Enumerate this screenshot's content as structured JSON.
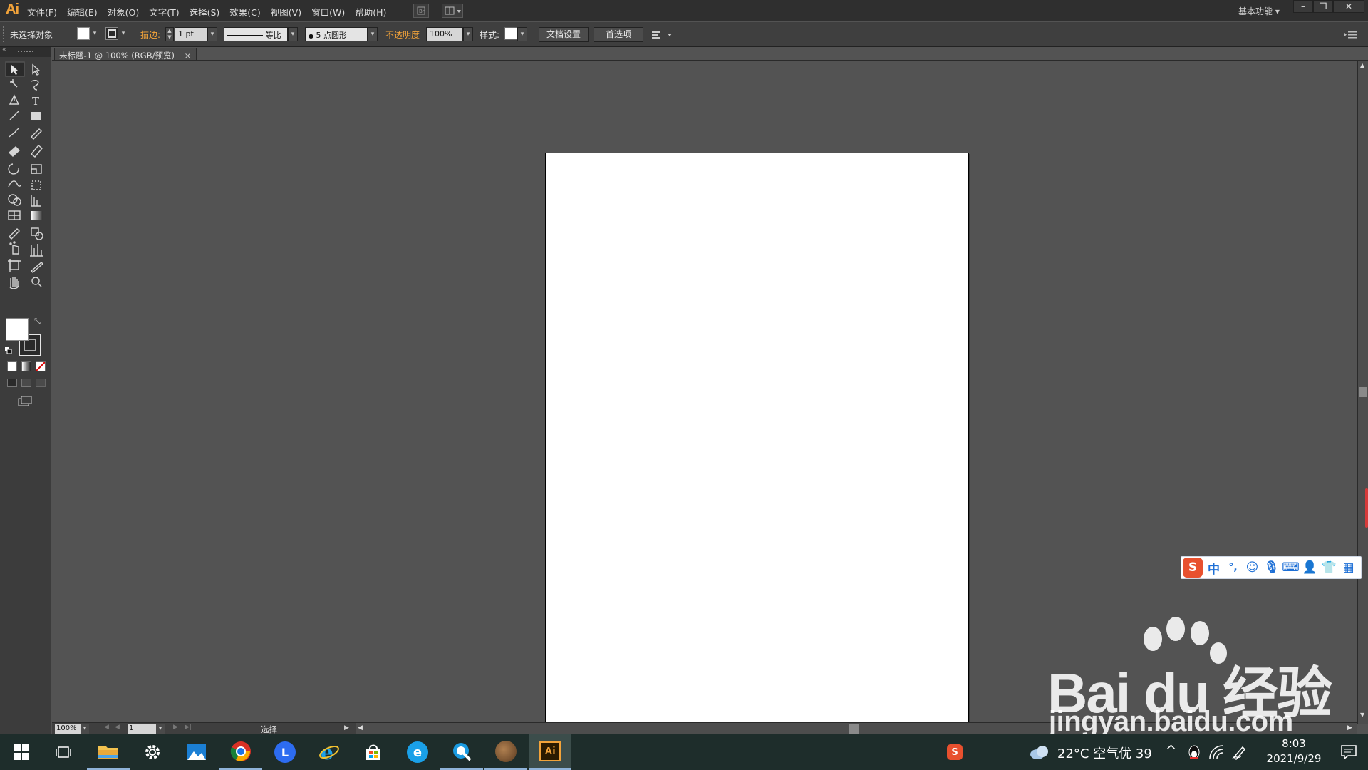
{
  "app": {
    "logo": "Ai",
    "menus": [
      "文件(F)",
      "编辑(E)",
      "对象(O)",
      "文字(T)",
      "选择(S)",
      "效果(C)",
      "视图(V)",
      "窗口(W)",
      "帮助(H)"
    ],
    "workspace": "基本功能",
    "window_controls": [
      "–",
      "❐",
      "✕"
    ]
  },
  "control_bar": {
    "selection_status": "未选择对象",
    "stroke_label": "描边:",
    "stroke_weight": "1 pt",
    "stroke_profile": "等比",
    "brush": "5 点圆形",
    "brush_dot": "●",
    "opacity_label": "不透明度",
    "opacity_value": "100%",
    "style_label": "样式:",
    "doc_setup_button": "文档设置",
    "preferences_button": "首选项"
  },
  "document": {
    "tab_title": "未标题-1 @ 100% (RGB/预览)",
    "tab_close": "×"
  },
  "status_bar": {
    "zoom": "100%",
    "artboard_number": "1",
    "tool_status": "选择"
  },
  "tools": [
    "selection-tool",
    "direct-selection-tool",
    "magic-wand-tool",
    "lasso-tool",
    "pen-tool",
    "type-tool",
    "line-tool",
    "rectangle-tool",
    "paintbrush-tool",
    "pencil-tool",
    "blob-brush-tool",
    "eraser-tool",
    "rotate-tool",
    "scale-tool",
    "warp-tool",
    "free-transform-tool",
    "shape-builder-tool",
    "perspective-grid-tool",
    "mesh-tool",
    "gradient-tool",
    "eyedropper-tool",
    "blend-tool",
    "symbol-sprayer-tool",
    "column-graph-tool",
    "artboard-tool",
    "slice-tool",
    "hand-tool",
    "zoom-tool"
  ],
  "ime": {
    "logo": "S",
    "mode": "中",
    "punct": "°,"
  },
  "watermark": {
    "brand": "Bai du 经验",
    "url": "jingyan.baidu.com"
  },
  "taskbar": {
    "weather": "22°C 空气优 39",
    "time": "8:03",
    "date": "2021/9/29",
    "ai_label": "Ai",
    "caret": "^"
  },
  "colors": {
    "accent_orange": "#f2a33a",
    "canvas_bg": "#535353",
    "taskbar_bg": "#1e2d2b"
  }
}
